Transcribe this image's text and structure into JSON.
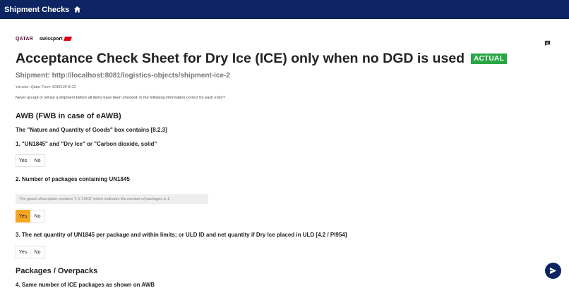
{
  "header": {
    "title": "Shipment Checks",
    "home_icon": "home-icon"
  },
  "logos": {
    "qatar": "QATAR",
    "swiss": "swissport"
  },
  "page": {
    "title": "Acceptance Check Sheet for Dry Ice (ICE) only when no DGD is used",
    "badge": "ACTUAL",
    "shipment": "Shipment: http://localhost:8081/logistics-objects/shipment-ice-2",
    "version": "Version: Qatar Form 3188139 B-22",
    "note": "Never accept or refuse a shipment before all items have been checked. Is the following information correct for each entry?"
  },
  "section_awb": {
    "title": "AWB (FWB in case of eAWB)",
    "subtitle": "The \"Nature and Quantity of Goods\" box contains [8.2.3]"
  },
  "questions": [
    {
      "label": "1. \"UN1845\" and \"Dry Ice\" or \"Carbon dioxide, solid\"",
      "yes": "Yes",
      "no": "No",
      "selected": "none"
    },
    {
      "label": "2. Number of packages containing UN1845",
      "hint": "The goods description contains '1 X 10KG' which indicates the number of packages is 1.",
      "yes": "Yes",
      "no": "No",
      "selected": "yes"
    },
    {
      "label": "3. The net quantity of UN1845 per package and within limits; or ULD ID and net quantity if Dry Ice placed in ULD [4.2 / PI954]",
      "yes": "Yes",
      "no": "No",
      "selected": "none"
    },
    {
      "label": "4. Same number of ICE packages as shown on AWB"
    }
  ],
  "section_packages": {
    "title": "Packages / Overpacks"
  },
  "colors": {
    "topbar": "#0c2461",
    "badge": "#28a745",
    "selected": "#f5a623"
  },
  "icons": {
    "comment": "comment-icon",
    "send": "send-icon"
  }
}
